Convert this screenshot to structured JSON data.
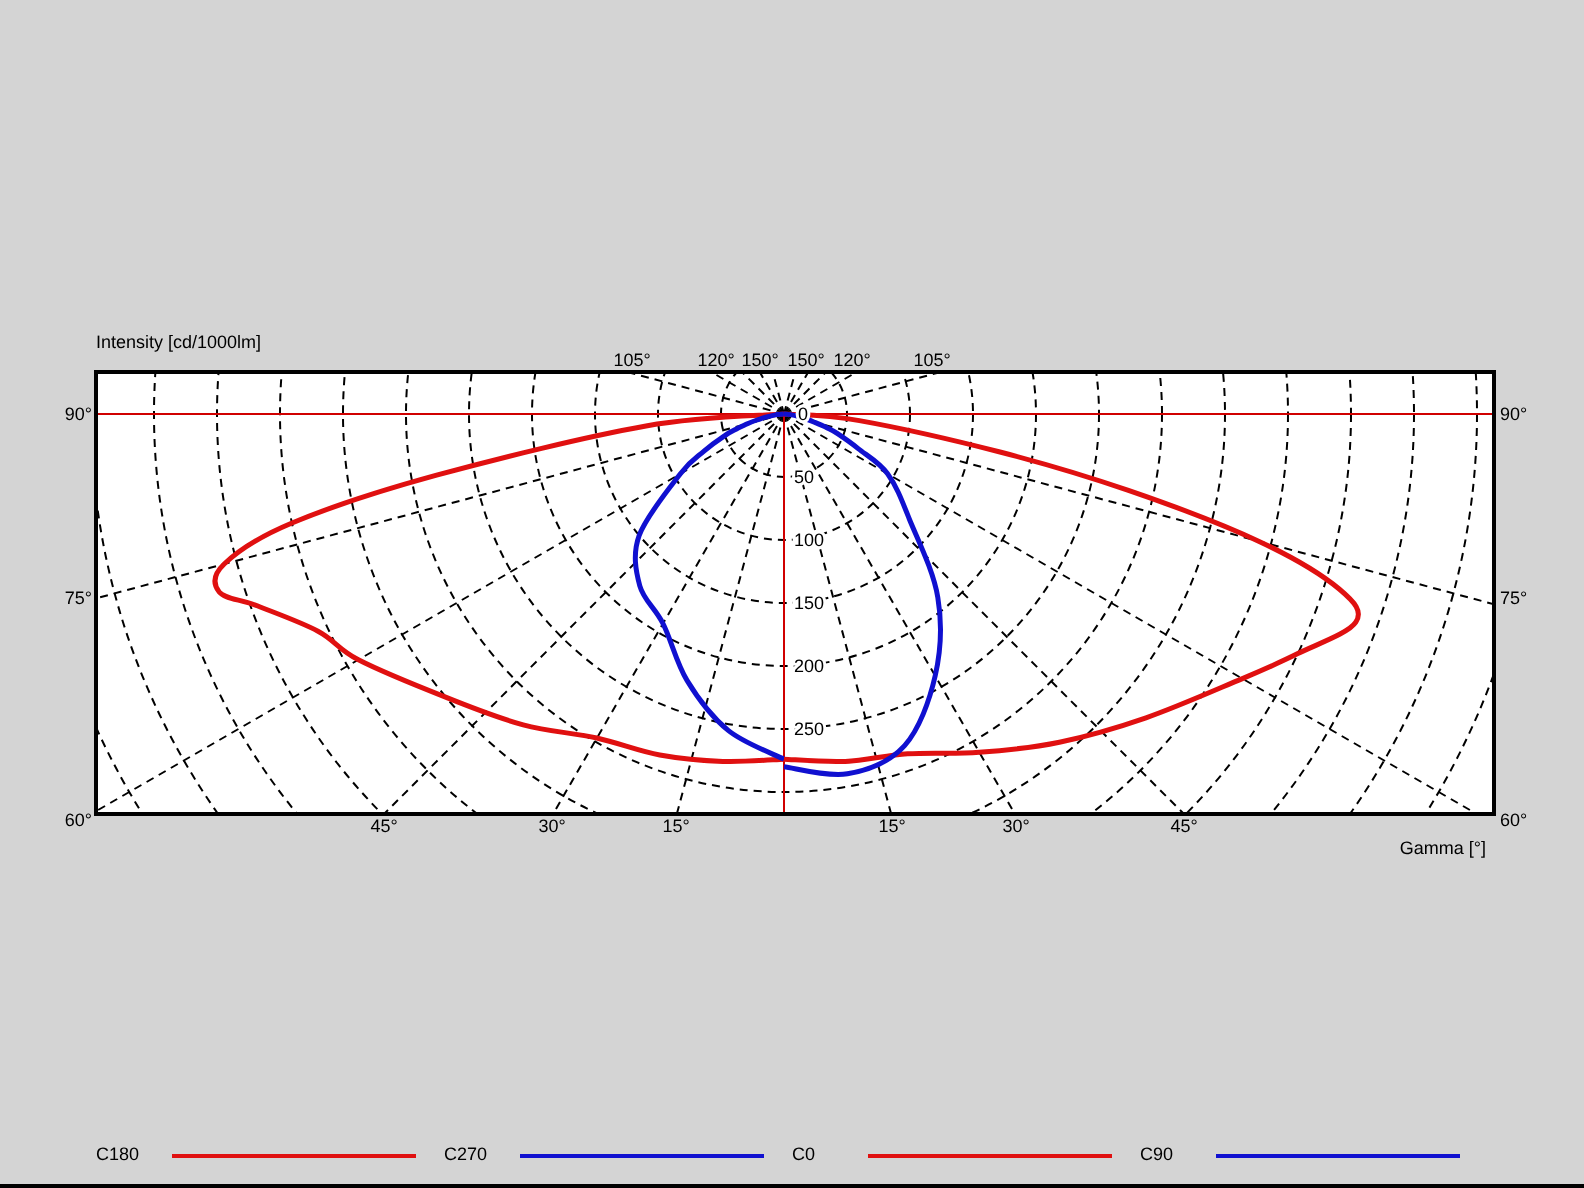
{
  "diagram": {
    "y_axis_title": "Intensity [cd/1000lm]",
    "x_axis_title": "Gamma [°]",
    "top_angle_labels": [
      "105°",
      "120°",
      "150°",
      "150°",
      "120°",
      "105°"
    ],
    "left_angle_labels": [
      "90°",
      "75°",
      "60°"
    ],
    "right_angle_labels": [
      "90°",
      "75°",
      "60°"
    ],
    "bottom_angle_labels": [
      "45°",
      "30°",
      "15°",
      "15°",
      "30°",
      "45°"
    ],
    "intensity_labels": [
      "0",
      "50",
      "100",
      "150",
      "200",
      "250"
    ]
  },
  "legend": [
    {
      "name": "C180",
      "color": "#e01010"
    },
    {
      "name": "C270",
      "color": "#1010d0"
    },
    {
      "name": "C0",
      "color": "#e01010"
    },
    {
      "name": "C90",
      "color": "#1010d0"
    }
  ]
}
